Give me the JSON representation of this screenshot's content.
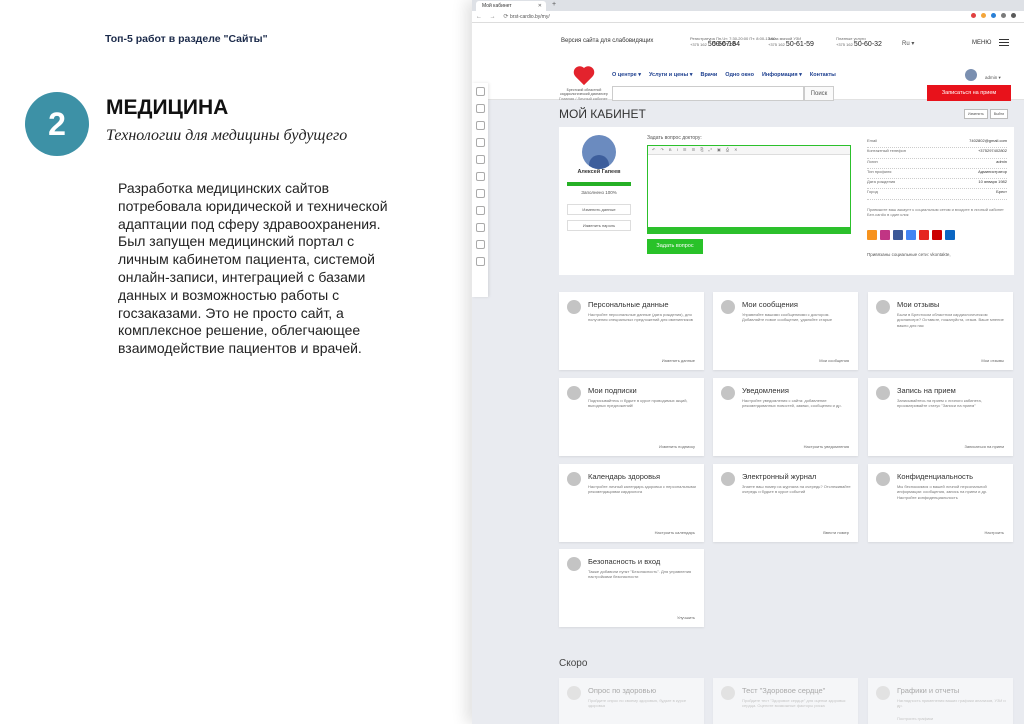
{
  "slide": {
    "top_label": "Топ-5 работ в разделе \"Сайты\"",
    "number": "2",
    "title": "МЕДИЦИНА",
    "subtitle": "Технологии для медицины будущего",
    "body": "Разработка медицинских сайтов потребовала юридической и технической адаптации под сферу здравоохранения. Был запущен медицинский портал с личным кабинетом пациента, системой онлайн-записи, интеграцией с базами данных и возможностью работы с госзаказами. Это не просто сайт, а комплексное решение, облегчающее взаимодействие пациентов и врачей."
  },
  "browser": {
    "tab_title": "Мой кабинет",
    "url": "brst-cardio.by/my/",
    "ext_colors": [
      "#e04040",
      "#f3a53a",
      "#2a7fd4",
      "#7a7a7a",
      "#5a5a5a"
    ]
  },
  "header": {
    "tagline": "Версия сайта для слабовидящих",
    "phones": [
      {
        "label": "Регистратура Пн-Чт: 7:30-20:00 Пт: 8:00-13:00",
        "code": "+375 162",
        "num": "50-60-18"
      },
      {
        "label": "",
        "code": "",
        "num": "50-67-64"
      },
      {
        "label": "Заказ мягкой УЗИ",
        "code": "+375 162",
        "num": "50-61-59"
      },
      {
        "label": "Платные услуги",
        "code": "+375 162",
        "num": "50-60-32"
      }
    ],
    "lang": "Ru ▾",
    "menu_label": "МЕНЮ",
    "logo_text": "Брестский областной кардиологический диспансер",
    "nav": [
      "О центре ▾",
      "Услуги и цены ▾",
      "Врачи",
      "Одно окно",
      "Информация ▾",
      "Контакты"
    ],
    "search_button": "Поиск",
    "book_button": "Записаться на прием",
    "user_name": "admin ▾"
  },
  "page": {
    "breadcrumb": "Главная / Личный кабинет",
    "title": "МОЙ КАБИНЕТ",
    "btn_edit": "Изменить",
    "btn_exit": "Выйти"
  },
  "profile": {
    "name": "Алексей Гапеев",
    "fill_fraction": 1.0,
    "fill_text": "Заполнено 100%",
    "btn_change_data": "Изменить данные",
    "btn_change_password": "Изменить пароль",
    "ask_label": "Задать вопрос доктору:",
    "editor_toolbar": "↶ ↷ B I ☰ ☰ ⎘ ⤢ ▣ ⎙ ✕",
    "ask_button": "Задать вопрос",
    "info": [
      {
        "k": "Email",
        "v": "7402802@gmail.com"
      },
      {
        "k": "Контактный телефон",
        "v": "+375297402802"
      },
      {
        "k": "Логин",
        "v": "admin"
      },
      {
        "k": "Тип профиля",
        "v": "Администратор"
      },
      {
        "k": "Дата рождения",
        "v": "10 января 1982"
      },
      {
        "k": "Город",
        "v": "Брест"
      }
    ],
    "social_note": "Привяжите ваш аккаунт к социальным сетям и входите в личный кабинет Бел.cardio в один клик",
    "social_colors": [
      "#f7931e",
      "#c13584",
      "#3b5998",
      "#4285f4",
      "#e52620",
      "#cc0000",
      "#0a66c2"
    ],
    "linked_label": "Привязаны социальные сети: vkontakte,"
  },
  "cards": [
    {
      "title": "Персональные данные",
      "desc": "Настройте персональные данные (дата рождения), для получения специальных предложений для именинников",
      "link": "Изменить данные"
    },
    {
      "title": "Мои сообщения",
      "desc": "Управляйте вашими сообщениями с доктором. Добавляйте новое сообщение, удаляйте старые",
      "link": "Мои сообщения"
    },
    {
      "title": "Мои отзывы",
      "desc": "Были в Брестском областном кардиологическом диспансере? Оставьте, пожалуйста, отзыв. Ваше мнение важно для нас",
      "link": "Мои отзывы"
    },
    {
      "title": "Мои подписки",
      "desc": "Подписывайтесь и будьте в курсе проводимых акций, выгодных предложений!",
      "link": "Изменить подписку"
    },
    {
      "title": "Уведомления",
      "desc": "Настройте уведомления с сайта: добавление рекомендованных новостей, заявки, сообщения и др.",
      "link": "Настроить уведомления"
    },
    {
      "title": "Запись на прием",
      "desc": "Записывайтесь на прием с личного кабинета, просматривайте статус \"Записи на прием\"",
      "link": "Записаться на прием"
    },
    {
      "title": "Календарь здоровья",
      "desc": "Настройте личный календарь здоровья с персональными рекомендациями кардиолога",
      "link": "Настроить календарь"
    },
    {
      "title": "Электронный журнал",
      "desc": "Знаете ваш номер из журнала на очередь? Отслеживайте очередь и будьте в курсе событий",
      "link": "Ввести номер"
    },
    {
      "title": "Конфиденциальность",
      "desc": "Мы беспокоимся о вашей личной персональной информации: сообщения, запись на прием и др. Настройте конфиденциальность",
      "link": "Настроить"
    },
    {
      "title": "Безопасность и вход",
      "desc": "Также добавили пункт \"Безопасность\". Для управления настройками безопасности",
      "link": "Улучшить"
    }
  ],
  "soon": {
    "title": "Скоро",
    "cards": [
      {
        "title": "Опрос по здоровью",
        "desc": "Пройдите опрос по своему здоровью, будьте в курсе здоровья"
      },
      {
        "title": "Тест \"Здоровое сердце\"",
        "desc": "Пройдите тест \"Здоровое сердце\" для оценки здоровья сердца. Оцените возможные факторы риска"
      },
      {
        "title": "Графики и отчеты",
        "desc": "Наглядность применения ваших графики анализов, УЗИ и др."
      }
    ],
    "card3_extra": "Построить графики"
  }
}
